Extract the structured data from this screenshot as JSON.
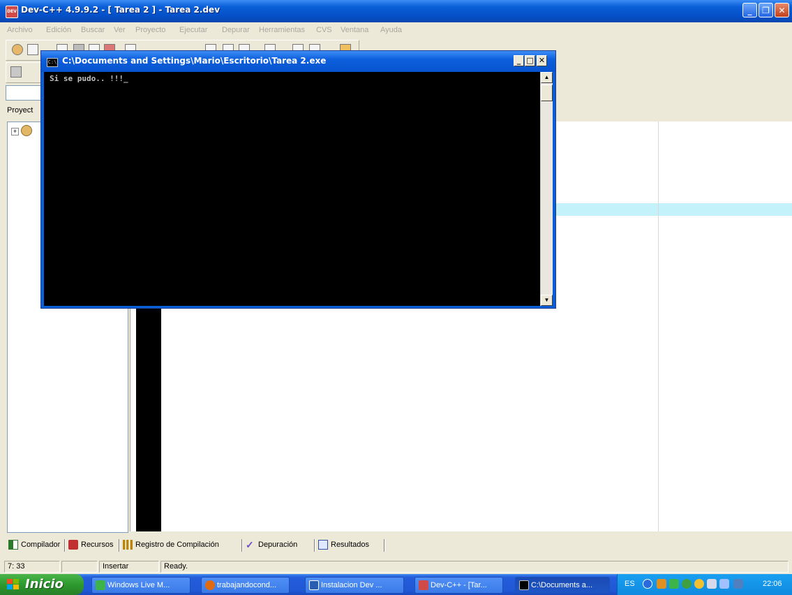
{
  "app": {
    "title": "Dev-C++ 4.9.9.2  - [ Tarea 2 ] - Tarea 2.dev",
    "icon": "devcpp-icon"
  },
  "menu": [
    "Archivo",
    "Edición",
    "Buscar",
    "Ver",
    "Proyecto",
    "Ejecutar",
    "Depurar",
    "Herramientas",
    "CVS",
    "Ventana",
    "Ayuda"
  ],
  "project_panel": {
    "tab_label": "Proyect"
  },
  "console": {
    "title": "C:\\Documents and Settings\\Mario\\Escritorio\\Tarea 2.exe",
    "output": "Si se pudo.. !!!",
    "cursor": "_"
  },
  "bottom_tabs": [
    {
      "label": "Compilador",
      "icon": "compiler-icon"
    },
    {
      "label": "Recursos",
      "icon": "resources-icon"
    },
    {
      "label": "Registro de Compilación",
      "icon": "log-chart-icon"
    },
    {
      "label": "Depuración",
      "icon": "checkmark-icon"
    },
    {
      "label": "Resultados",
      "icon": "search-results-icon"
    }
  ],
  "status": {
    "position": "7: 33",
    "mode": "Insertar",
    "state": "Ready."
  },
  "taskbar": {
    "start_label": "Inicio",
    "tasks": [
      {
        "label": "Windows Live M...",
        "icon": "messenger-icon"
      },
      {
        "label": "trabajandocond...",
        "icon": "firefox-icon"
      },
      {
        "label": "Instalacion Dev ...",
        "icon": "word-icon"
      },
      {
        "label": "Dev-C++ - [Tar...",
        "icon": "devcpp-icon"
      },
      {
        "label": "C:\\Documents a...",
        "icon": "console-icon"
      }
    ],
    "language": "ES",
    "clock": "22:06"
  },
  "colors": {
    "highlight_line": "#c4f2fb",
    "titlebar": "#0A5FD8",
    "console_bg": "#000000"
  }
}
